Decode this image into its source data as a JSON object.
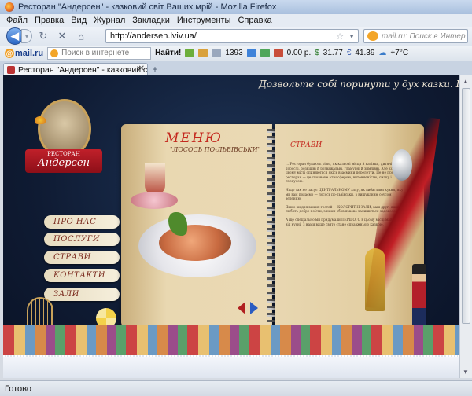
{
  "window": {
    "title": "Ресторан \"Андерсен\" - казковий світ Ваших мрій - Mozilla Firefox"
  },
  "menubar": {
    "items": [
      "Файл",
      "Правка",
      "Вид",
      "Журнал",
      "Закладки",
      "Инструменты",
      "Справка"
    ]
  },
  "navbar": {
    "url": "http://andersen.lviv.ua/",
    "search_placeholder": "mail.ru: Поиск в Интер"
  },
  "toolbar": {
    "brand": "mail.ru",
    "search_placeholder": "Поиск в интернете",
    "find_label": "Найти!",
    "mail_count": "1393",
    "money": "0.00 р.",
    "usd": "31.77",
    "eur": "41.39",
    "weather": "+7°C"
  },
  "tabs": [
    {
      "label": "Ресторан \"Андерсен\" - казковий св..."
    }
  ],
  "page": {
    "slogan": "Дозвольте собі поринути у дух казки. І казка настане...",
    "logo_small": "РЕСТОРАН",
    "logo_name": "Андерсен",
    "nav": [
      "ПРО НАС",
      "ПОСЛУГИ",
      "СТРАВИ",
      "КОНТАКТИ",
      "ЗАЛИ"
    ],
    "menu_title": "МЕНЮ",
    "menu_subtitle": "\"ЛОСОСЬ ПО-ЛЬВІВСЬКИ\"",
    "section_title": "СТРАВИ",
    "paragraphs": [
      "… Ресторан бувають різні, як казкові місця й катівки, дитячі й дорослі, розкішні й розважальні, гламурні й зимлівні. Але коли у цьому місті опиняються якісь взаємини перелетти. Це не просто ресторан — це сповнене атмосферою, витонченістю, смаку і спокусою.",
      "Ніщо так не пасує ЦЕНТРАЛЬНОМУ залу, як вибаглива кухня, яку ми вам подаємо — лосось по-львівськи, з вишуканим соусом і зеленню.",
      "Якщо ви для ваших гостей — КОЛОРИТНІ ЗАЛИ, ваш друг, який любить добре поїсти, з нами обов'язково залишиться задоволеним.",
      "А ще спеціально ми придумали ПЕРШОГО в цьому місці майстра від кухні. З нами ваше свято стане справжньою казкою."
    ]
  },
  "status": "Готово",
  "colors": {
    "accent_red": "#c4281e",
    "page_bg": "#0f1b33",
    "parchment": "#e9d8b1"
  }
}
